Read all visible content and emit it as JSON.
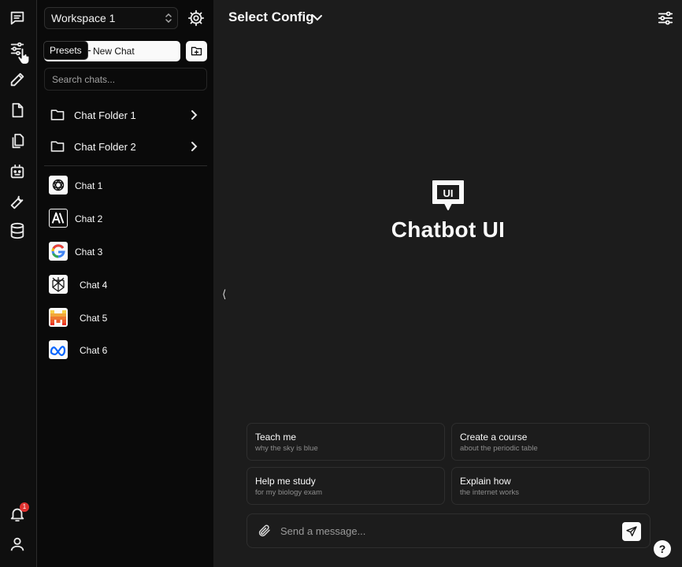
{
  "rail": {
    "icons": [
      "chat-icon",
      "presets-icon",
      "prompts-icon",
      "files-icon",
      "collections-icon",
      "assistants-icon",
      "tools-icon",
      "models-icon"
    ],
    "notification_count": "1"
  },
  "sidebar": {
    "workspace": "Workspace 1",
    "new_chat_label": "New Chat",
    "tooltip": "Presets",
    "search_placeholder": "Search chats...",
    "folders": [
      {
        "label": "Chat Folder 1"
      },
      {
        "label": "Chat Folder 2"
      }
    ],
    "chats": [
      {
        "label": "Chat 1",
        "icon": "openai-icon"
      },
      {
        "label": "Chat 2",
        "icon": "anthropic-icon"
      },
      {
        "label": "Chat 3",
        "icon": "google-icon"
      },
      {
        "label": "Chat 4",
        "icon": "perplexity-icon"
      },
      {
        "label": "Chat 5",
        "icon": "mistral-icon"
      },
      {
        "label": "Chat 6",
        "icon": "meta-icon"
      }
    ]
  },
  "main": {
    "config_label": "Select Config",
    "logo_badge": "UI",
    "brand": "Chatbot UI",
    "suggestions": [
      {
        "title": "Teach me",
        "subtitle": "why the sky is blue"
      },
      {
        "title": "Create a course",
        "subtitle": "about the periodic table"
      },
      {
        "title": "Help me study",
        "subtitle": "for my biology exam"
      },
      {
        "title": "Explain how",
        "subtitle": "the internet works"
      }
    ],
    "message_placeholder": "Send a message...",
    "help_label": "?"
  },
  "colors": {
    "main_bg": "#1c1c1c",
    "sidebar_bg": "#0a0a0a",
    "rail_bg": "#0f0f0f",
    "accent": "#fafafa",
    "badge": "#e0312f"
  }
}
